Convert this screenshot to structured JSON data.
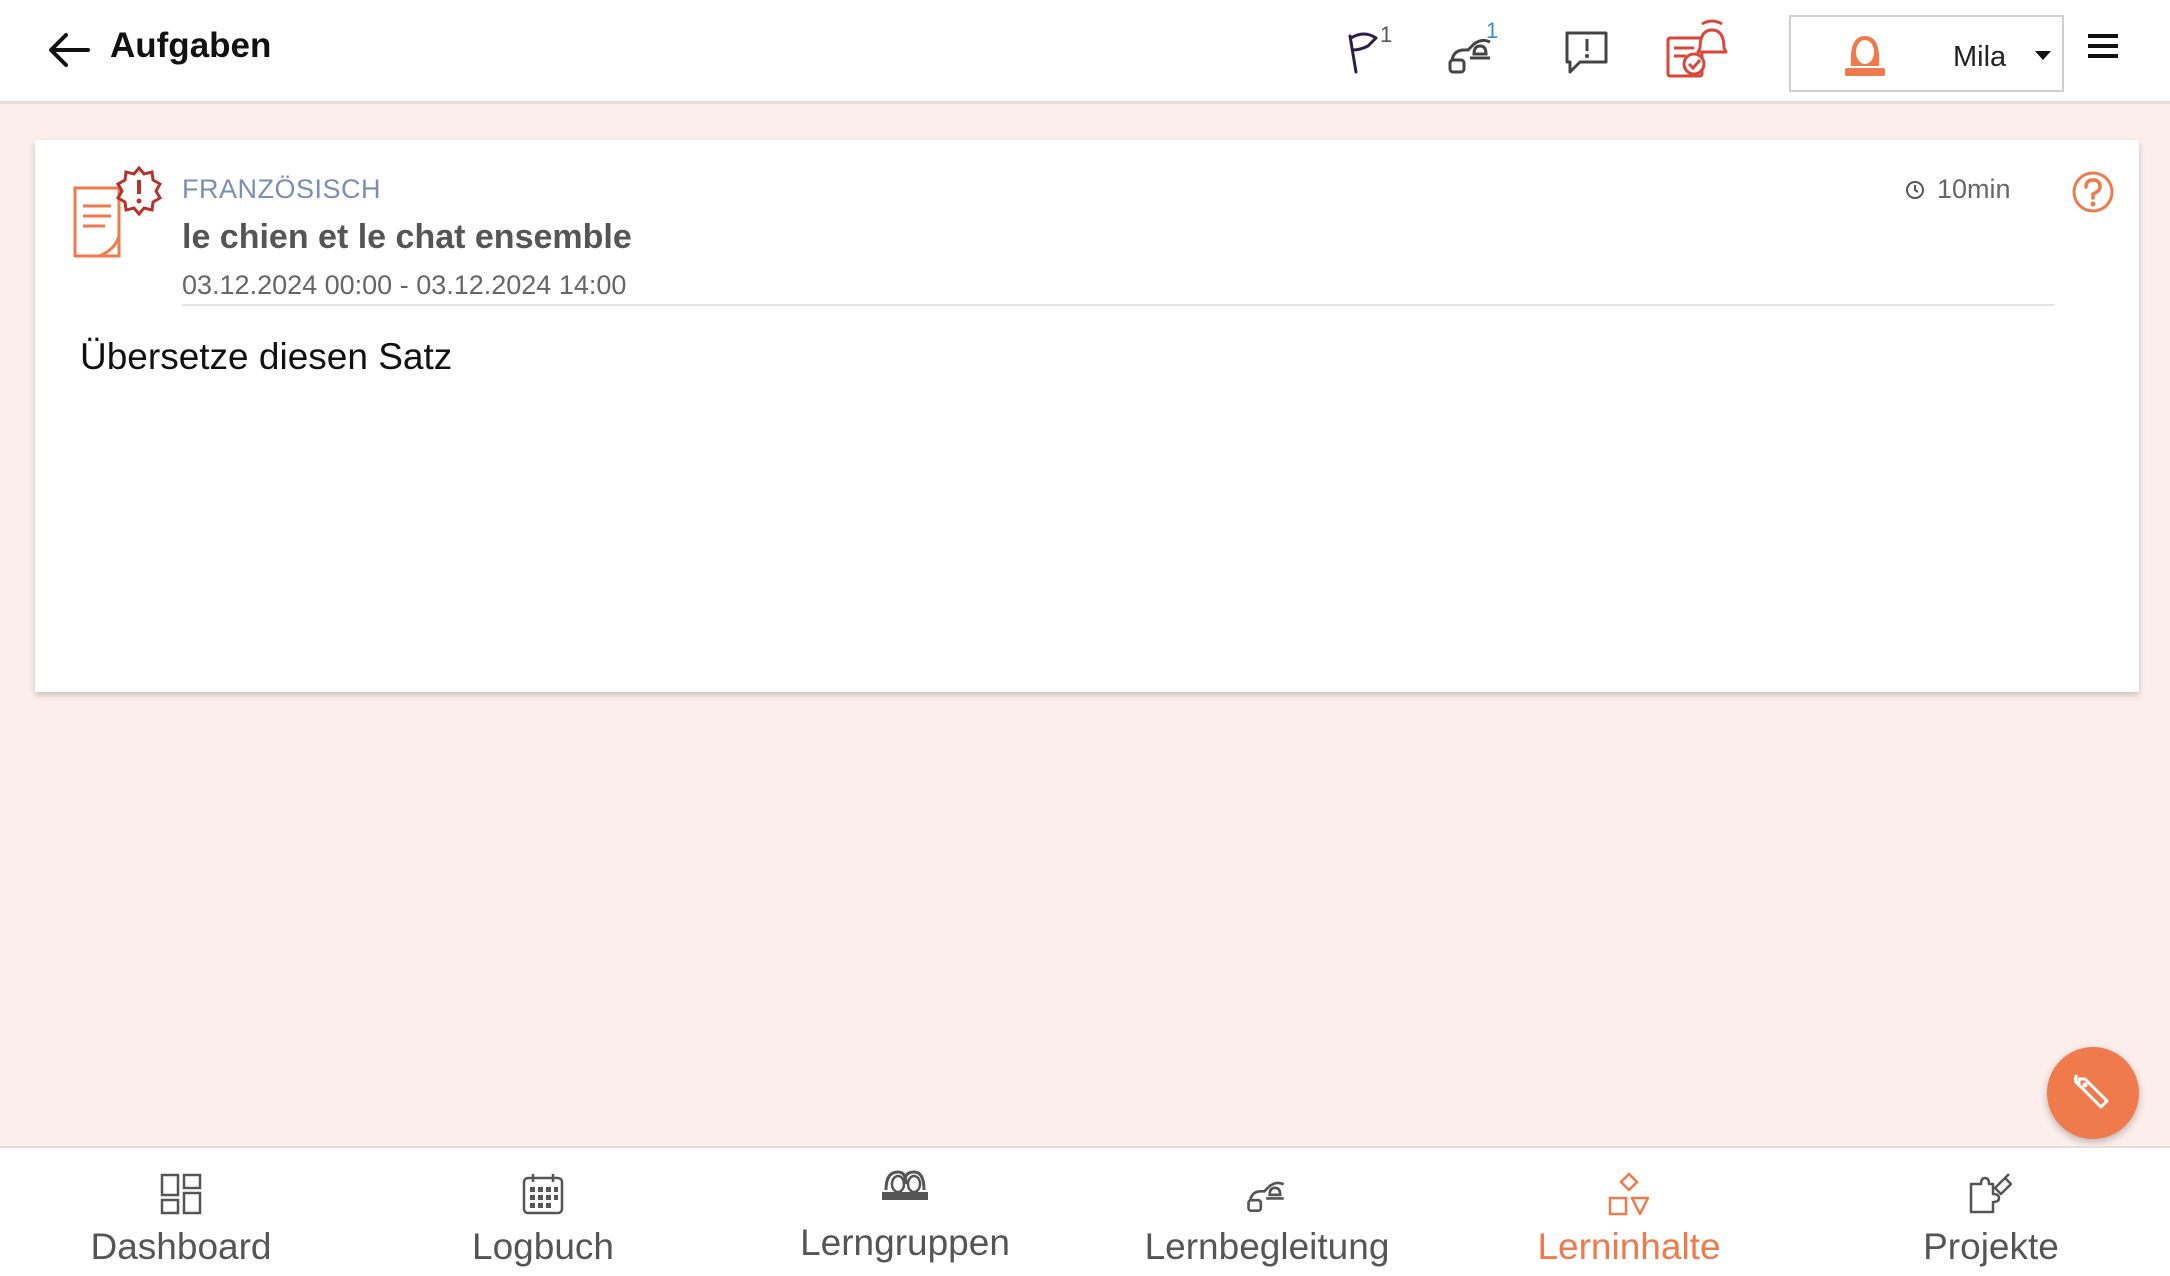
{
  "header": {
    "title": "Aufgaben",
    "icons": {
      "flag_badge": "1",
      "support_badge": "1"
    },
    "user": {
      "name": "Mila"
    }
  },
  "task": {
    "subject": "FRANZÖSISCH",
    "title": "le chien et le chat ensemble",
    "date_range": "03.12.2024 00:00 - 03.12.2024 14:00",
    "duration": "10min",
    "description": "Übersetze diesen Satz"
  },
  "nav": {
    "items": [
      {
        "label": "Dashboard"
      },
      {
        "label": "Logbuch"
      },
      {
        "label": "Lerngruppen"
      },
      {
        "label": "Lernbegleitung"
      },
      {
        "label": "Lerninhalte"
      },
      {
        "label": "Projekte"
      }
    ]
  },
  "colors": {
    "accent": "#ef7a4b",
    "alert_red": "#d9463a",
    "background": "#fceeea",
    "subject_blue": "#7a8eb5"
  }
}
